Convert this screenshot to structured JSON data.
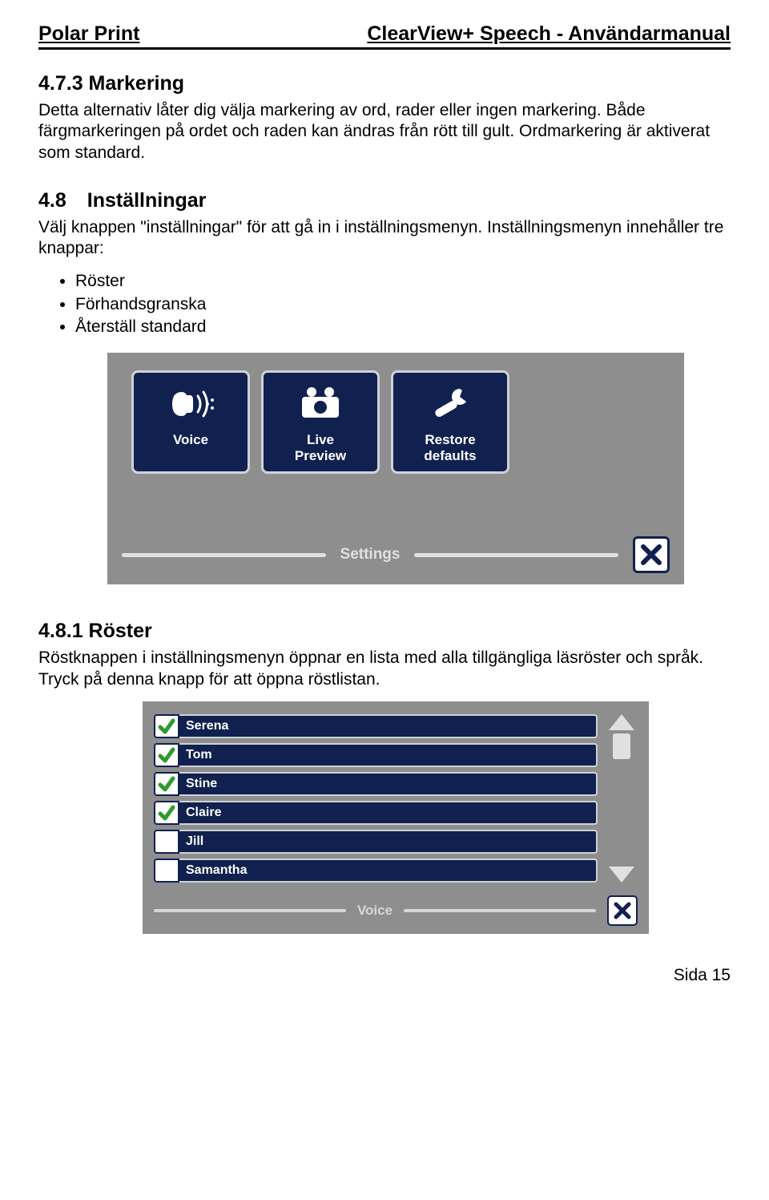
{
  "header": {
    "left": "Polar Print",
    "right": "ClearView+ Speech - Användarmanual"
  },
  "section_473": {
    "heading": "4.7.3 Markering",
    "body": "Detta alternativ låter dig välja markering av ord, rader eller ingen markering. Både färgmarkeringen på ordet och raden kan ändras från rött till gult. Ordmarkering är aktiverat som standard."
  },
  "section_48": {
    "number": "4.8",
    "title": "Inställningar",
    "body": "Välj knappen \"inställningar\" för att gå in i inställningsmenyn. Inställningsmenyn innehåller tre knappar:",
    "bullets": [
      "Röster",
      "Förhandsgranska",
      "Återställ standard"
    ]
  },
  "settings_screenshot": {
    "buttons": [
      {
        "label": "Voice"
      },
      {
        "label": "Live\nPreview"
      },
      {
        "label": "Restore\ndefaults"
      }
    ],
    "caption": "Settings"
  },
  "section_481": {
    "heading": "4.8.1 Röster",
    "body": "Röstknappen i inställningsmenyn öppnar en lista med alla tillgängliga läsröster och språk. Tryck på denna knapp för att öppna röstlistan."
  },
  "voice_screenshot": {
    "items": [
      {
        "name": "Serena",
        "checked": true
      },
      {
        "name": "Tom",
        "checked": true
      },
      {
        "name": "Stine",
        "checked": true
      },
      {
        "name": "Claire",
        "checked": true
      },
      {
        "name": "Jill",
        "checked": false
      },
      {
        "name": "Samantha",
        "checked": false
      }
    ],
    "caption": "Voice"
  },
  "page_label": "Sida 15"
}
